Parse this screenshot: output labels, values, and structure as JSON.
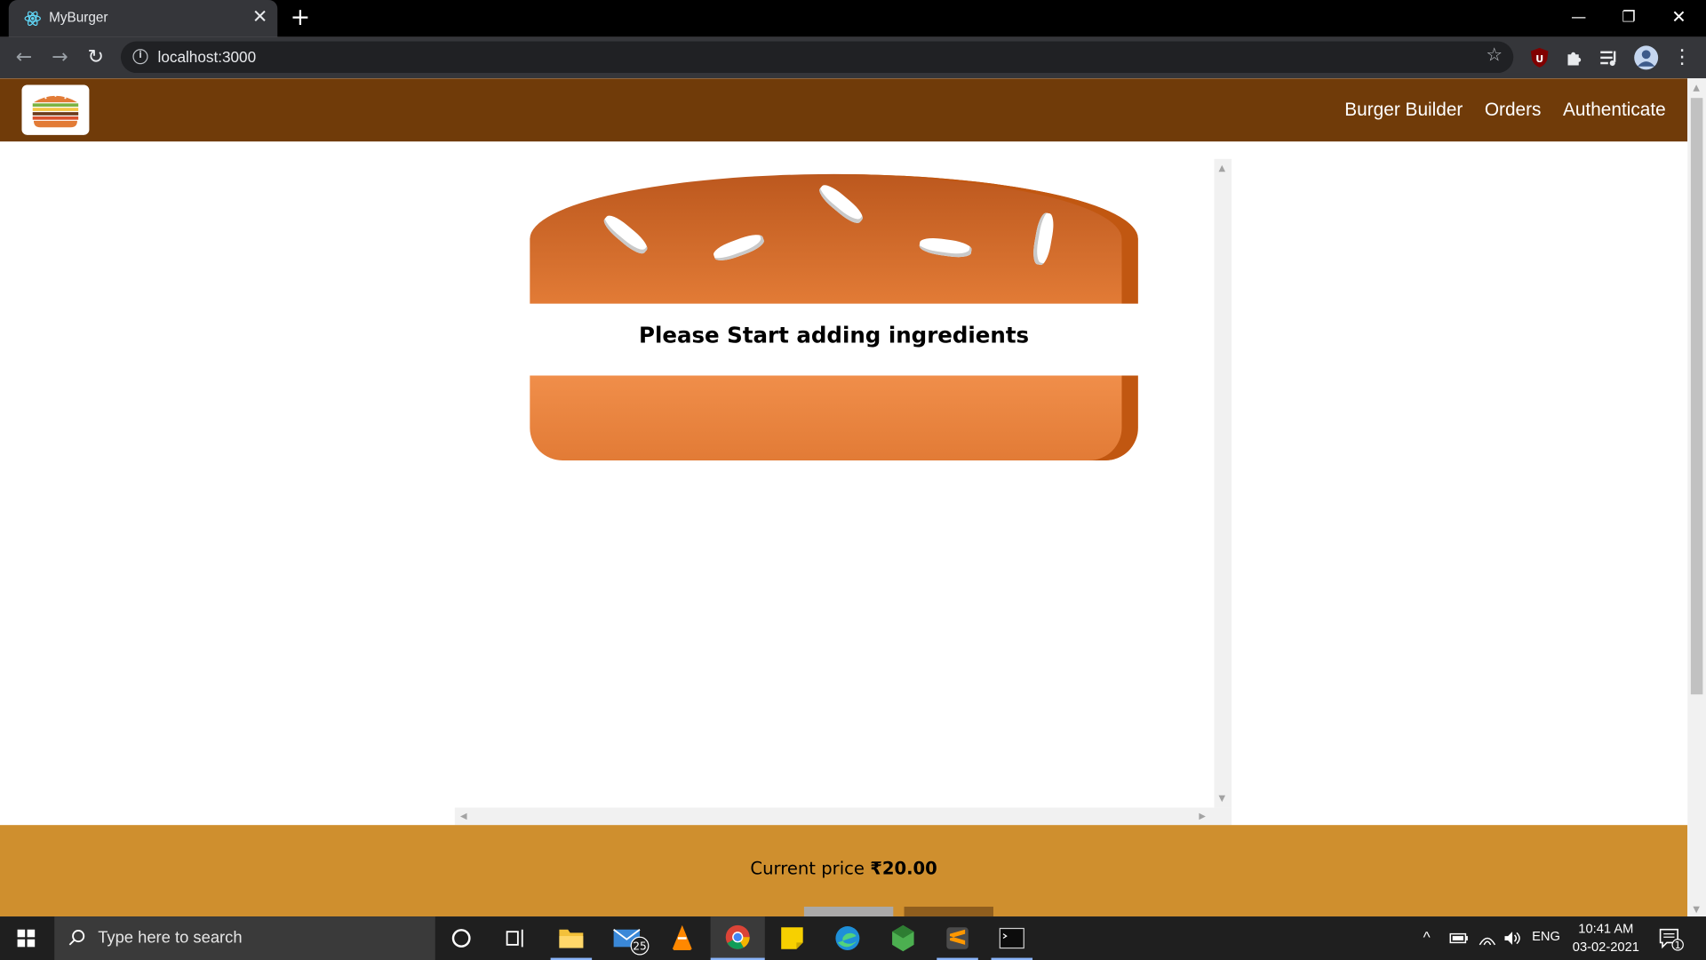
{
  "browser": {
    "tab_title": "MyBurger",
    "url": "localhost:3000",
    "new_tab": "+",
    "tab_close": "✕"
  },
  "navbar": {
    "links": [
      "Burger Builder",
      "Orders",
      "Authenticate"
    ]
  },
  "burger": {
    "empty_message": "Please Start adding ingredients"
  },
  "build_controls": {
    "price_label": "Current price",
    "price_value": "₹20.00"
  },
  "taskbar": {
    "search_placeholder": "Type here to search",
    "mail_badge": "25",
    "language": "ENG",
    "time": "10:41 AM",
    "date": "03-02-2021",
    "notification_count": "1"
  }
}
